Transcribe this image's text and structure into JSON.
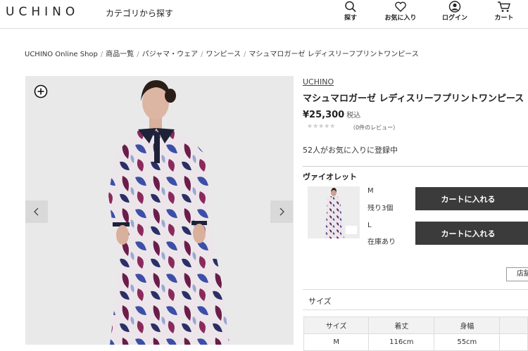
{
  "header": {
    "logo": "UCHINO",
    "category_label": "カテゴリから探す",
    "icons": [
      {
        "name": "search-icon",
        "label": "探す"
      },
      {
        "name": "heart-icon",
        "label": "お気に入り"
      },
      {
        "name": "user-icon",
        "label": "ログイン"
      },
      {
        "name": "cart-icon",
        "label": "カート"
      }
    ]
  },
  "breadcrumb": {
    "items": [
      "UCHINO Online Shop",
      "商品一覧",
      "パジャマ・ウェア",
      "ワンピース",
      "マシュマロガーゼ レディスリーフプリントワンピース"
    ],
    "separator": "/"
  },
  "product": {
    "brand": "UCHINO",
    "title": "マシュマロガーゼ レディスリーフプリントワンピース",
    "price": "¥25,300",
    "tax_label": "税込",
    "stars": "★★★★★",
    "review_count": "（0件のレビュー）",
    "favorites": "52人がお気に入りに登録中",
    "color_name": "ヴァイオレット",
    "variants": [
      {
        "size": "M",
        "stock": "残り3個",
        "button": "カートに入れる"
      },
      {
        "size": "L",
        "stock": "在庫あり",
        "button": "カートに入れる"
      }
    ],
    "store_button": "店舗"
  },
  "size_section": {
    "label": "サイズ",
    "table": {
      "headers": [
        "サイズ",
        "着丈",
        "身幅"
      ],
      "rows": [
        [
          "M",
          "116cm",
          "55cm"
        ]
      ]
    }
  },
  "colors": {
    "dark_button": "#3b3b3b",
    "print_purple": "#6b1d4a",
    "print_blue": "#3c4fa8",
    "collar_navy": "#1d2238"
  }
}
